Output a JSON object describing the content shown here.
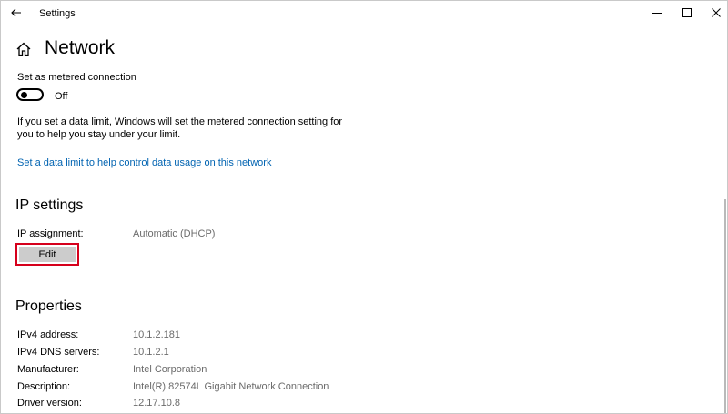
{
  "window": {
    "title": "Settings"
  },
  "page": {
    "title": "Network"
  },
  "metered": {
    "label": "Set as metered connection",
    "toggle_state": "Off",
    "description": "If you set a data limit, Windows will set the metered connection setting for you to help you stay under your limit.",
    "link": "Set a data limit to help control data usage on this network"
  },
  "ip_settings": {
    "title": "IP settings",
    "assignment_label": "IP assignment:",
    "assignment_value": "Automatic (DHCP)",
    "edit_label": "Edit"
  },
  "properties": {
    "title": "Properties",
    "rows": [
      {
        "label": "IPv4 address:",
        "value": "10.1.2.181"
      },
      {
        "label": "IPv4 DNS servers:",
        "value": "10.1.2.1"
      },
      {
        "label": "Manufacturer:",
        "value": "Intel Corporation"
      },
      {
        "label": "Description:",
        "value": "Intel(R) 82574L Gigabit Network Connection"
      },
      {
        "label": "Driver version:",
        "value": "12.17.10.8"
      }
    ]
  },
  "icons": {
    "back": "back-arrow-icon",
    "home": "home-icon",
    "minimize": "minimize-icon",
    "maximize": "maximize-icon",
    "close": "close-icon"
  },
  "colors": {
    "link": "#0063b1",
    "highlight": "#d6001c",
    "button": "#cccccc",
    "secondary_text": "#6b6b6b"
  }
}
